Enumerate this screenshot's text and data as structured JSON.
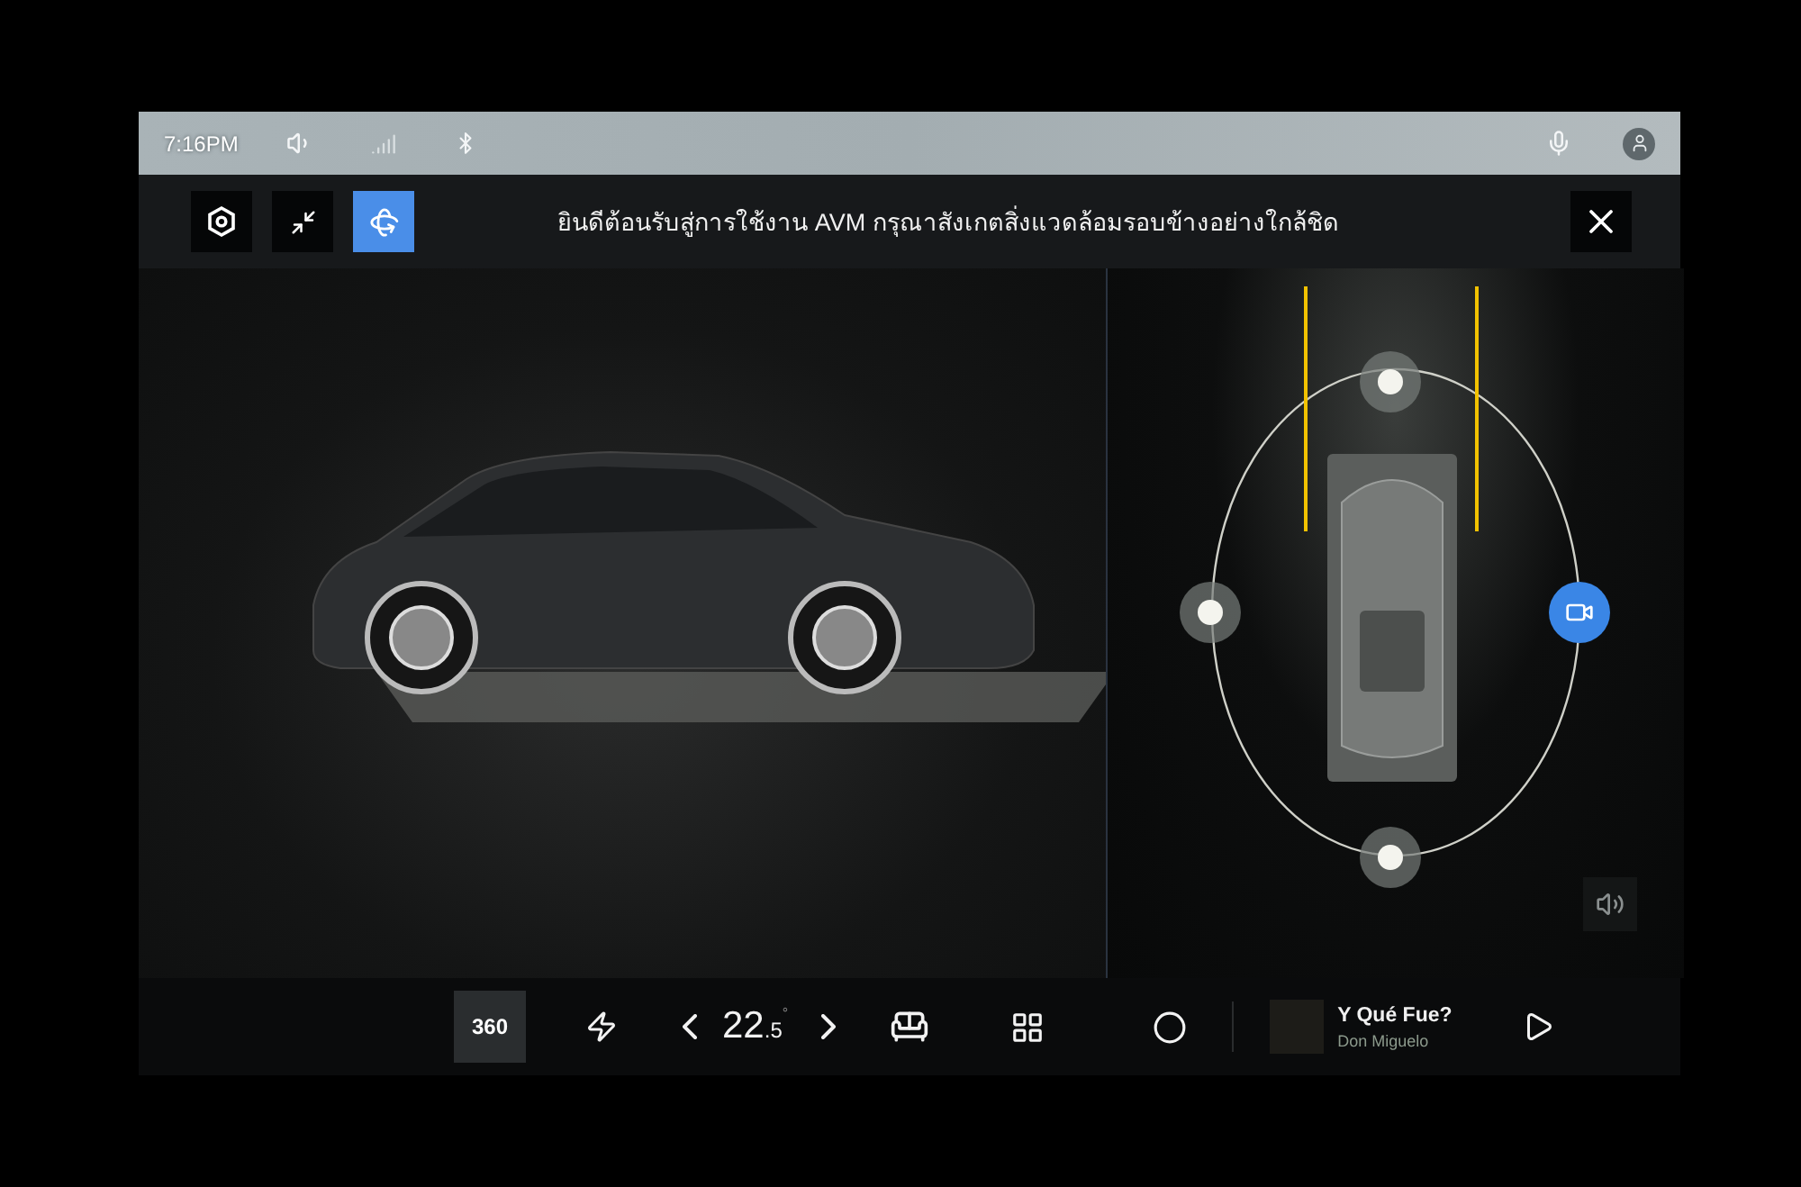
{
  "status_bar": {
    "time": "7:16PM"
  },
  "toolbar": {
    "buttons": [
      {
        "kind": "settings",
        "selected": false
      },
      {
        "kind": "shrink",
        "selected": false
      },
      {
        "kind": "view3d",
        "selected": true
      }
    ],
    "message": "ยินดีต้อนรับสู่การใช้งาน AVM กรุณาสังเกตสิ่งแวดล้อมรอบข้างอย่างใกล้ชิด"
  },
  "camera_views": [
    {
      "selected": false
    },
    {
      "selected": false
    },
    {
      "selected": true
    },
    {
      "selected": false
    }
  ],
  "dock": {
    "view_button": "360",
    "temperature": {
      "whole": "22",
      "decimal": ".5",
      "unit": "°"
    },
    "media": {
      "title": "Y Qué Fue?",
      "artist": "Don Miguelo"
    }
  }
}
